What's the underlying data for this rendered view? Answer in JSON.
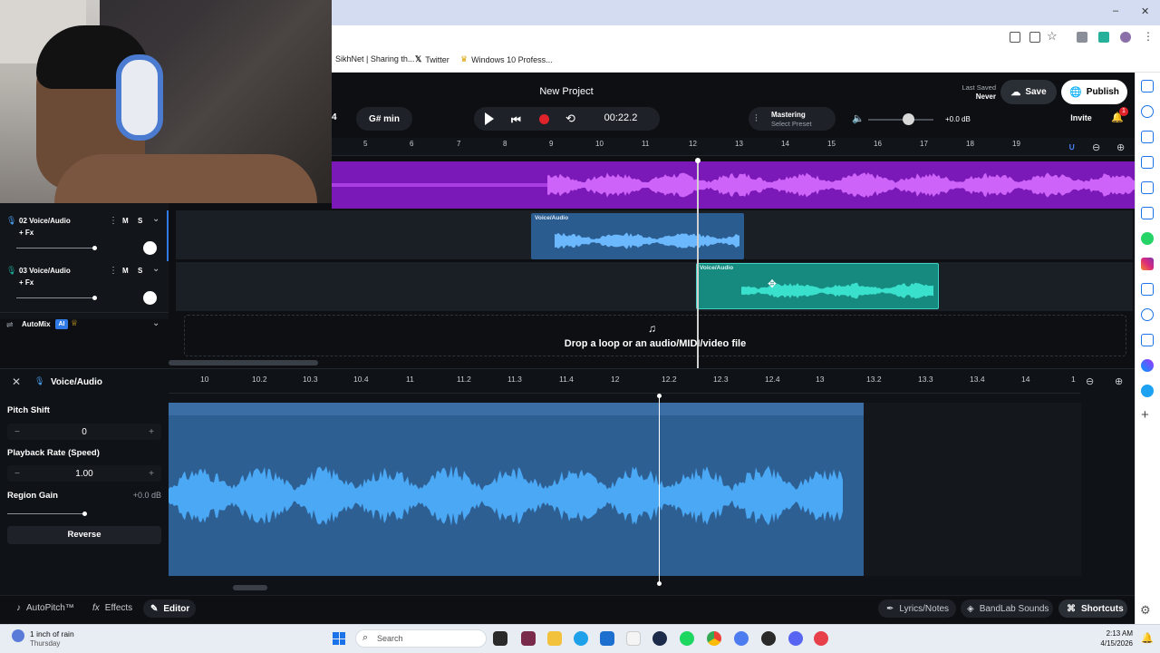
{
  "browser": {
    "bookmarks": [
      "SikhNet | Sharing th...",
      "Twitter",
      "Windows 10 Profess..."
    ],
    "window_controls": [
      "–",
      "❐",
      "✕"
    ]
  },
  "header": {
    "project_title": "New Project",
    "last_saved_label": "Last Saved",
    "last_saved_value": "Never",
    "save_label": "Save",
    "publish_label": "Publish",
    "invite_label": "Invite",
    "notification_count": "1",
    "time_sig_partial": "4",
    "key": "G# min",
    "time": "00:22.2",
    "mastering_label": "Mastering",
    "mastering_sub": "Select Preset",
    "volume_db": "+0.0 dB"
  },
  "timeline": {
    "bars": [
      "5",
      "6",
      "7",
      "8",
      "9",
      "10",
      "11",
      "12",
      "13",
      "14",
      "15",
      "16",
      "17",
      "18",
      "19"
    ]
  },
  "tracks": [
    {
      "name": "02  Voice/Audio",
      "fx": "+ Fx",
      "mute": "M",
      "solo": "S",
      "region_label": "Voice/Audio"
    },
    {
      "name": "03  Voice/Audio",
      "fx": "+ Fx",
      "mute": "M",
      "solo": "S",
      "region_label": "Voice/Audio"
    }
  ],
  "automix": {
    "label": "AutoMix",
    "badge": "AI"
  },
  "dropzone": {
    "text": "Drop a loop or an audio/MIDI/video file"
  },
  "editor": {
    "title": "Voice/Audio",
    "pitch_shift_label": "Pitch Shift",
    "pitch_shift_value": "0",
    "playback_rate_label": "Playback Rate (Speed)",
    "playback_rate_value": "1.00",
    "region_gain_label": "Region Gain",
    "region_gain_value": "+0.0 dB",
    "reverse_label": "Reverse",
    "ruler": [
      "10",
      "10.2",
      "10.3",
      "10.4",
      "11",
      "11.2",
      "11.3",
      "11.4",
      "12",
      "12.2",
      "12.3",
      "12.4",
      "13",
      "13.2",
      "13.3",
      "13.4",
      "14",
      "1"
    ]
  },
  "footer": {
    "autopitch": "AutoPitch™",
    "effects": "Effects",
    "editor": "Editor",
    "lyrics": "Lyrics/Notes",
    "sounds": "BandLab Sounds",
    "shortcuts": "Shortcuts"
  },
  "taskbar": {
    "weather_line1": "1 inch of rain",
    "weather_line2": "Thursday",
    "search_placeholder": "Search",
    "time": "2:13 AM",
    "date": "4/15/2026"
  },
  "colors": {
    "purple_track": "#9a1fd8",
    "blue_region": "#2f6fb0",
    "teal_region": "#1fa89a",
    "editor_wave": "#4aa3f0"
  }
}
